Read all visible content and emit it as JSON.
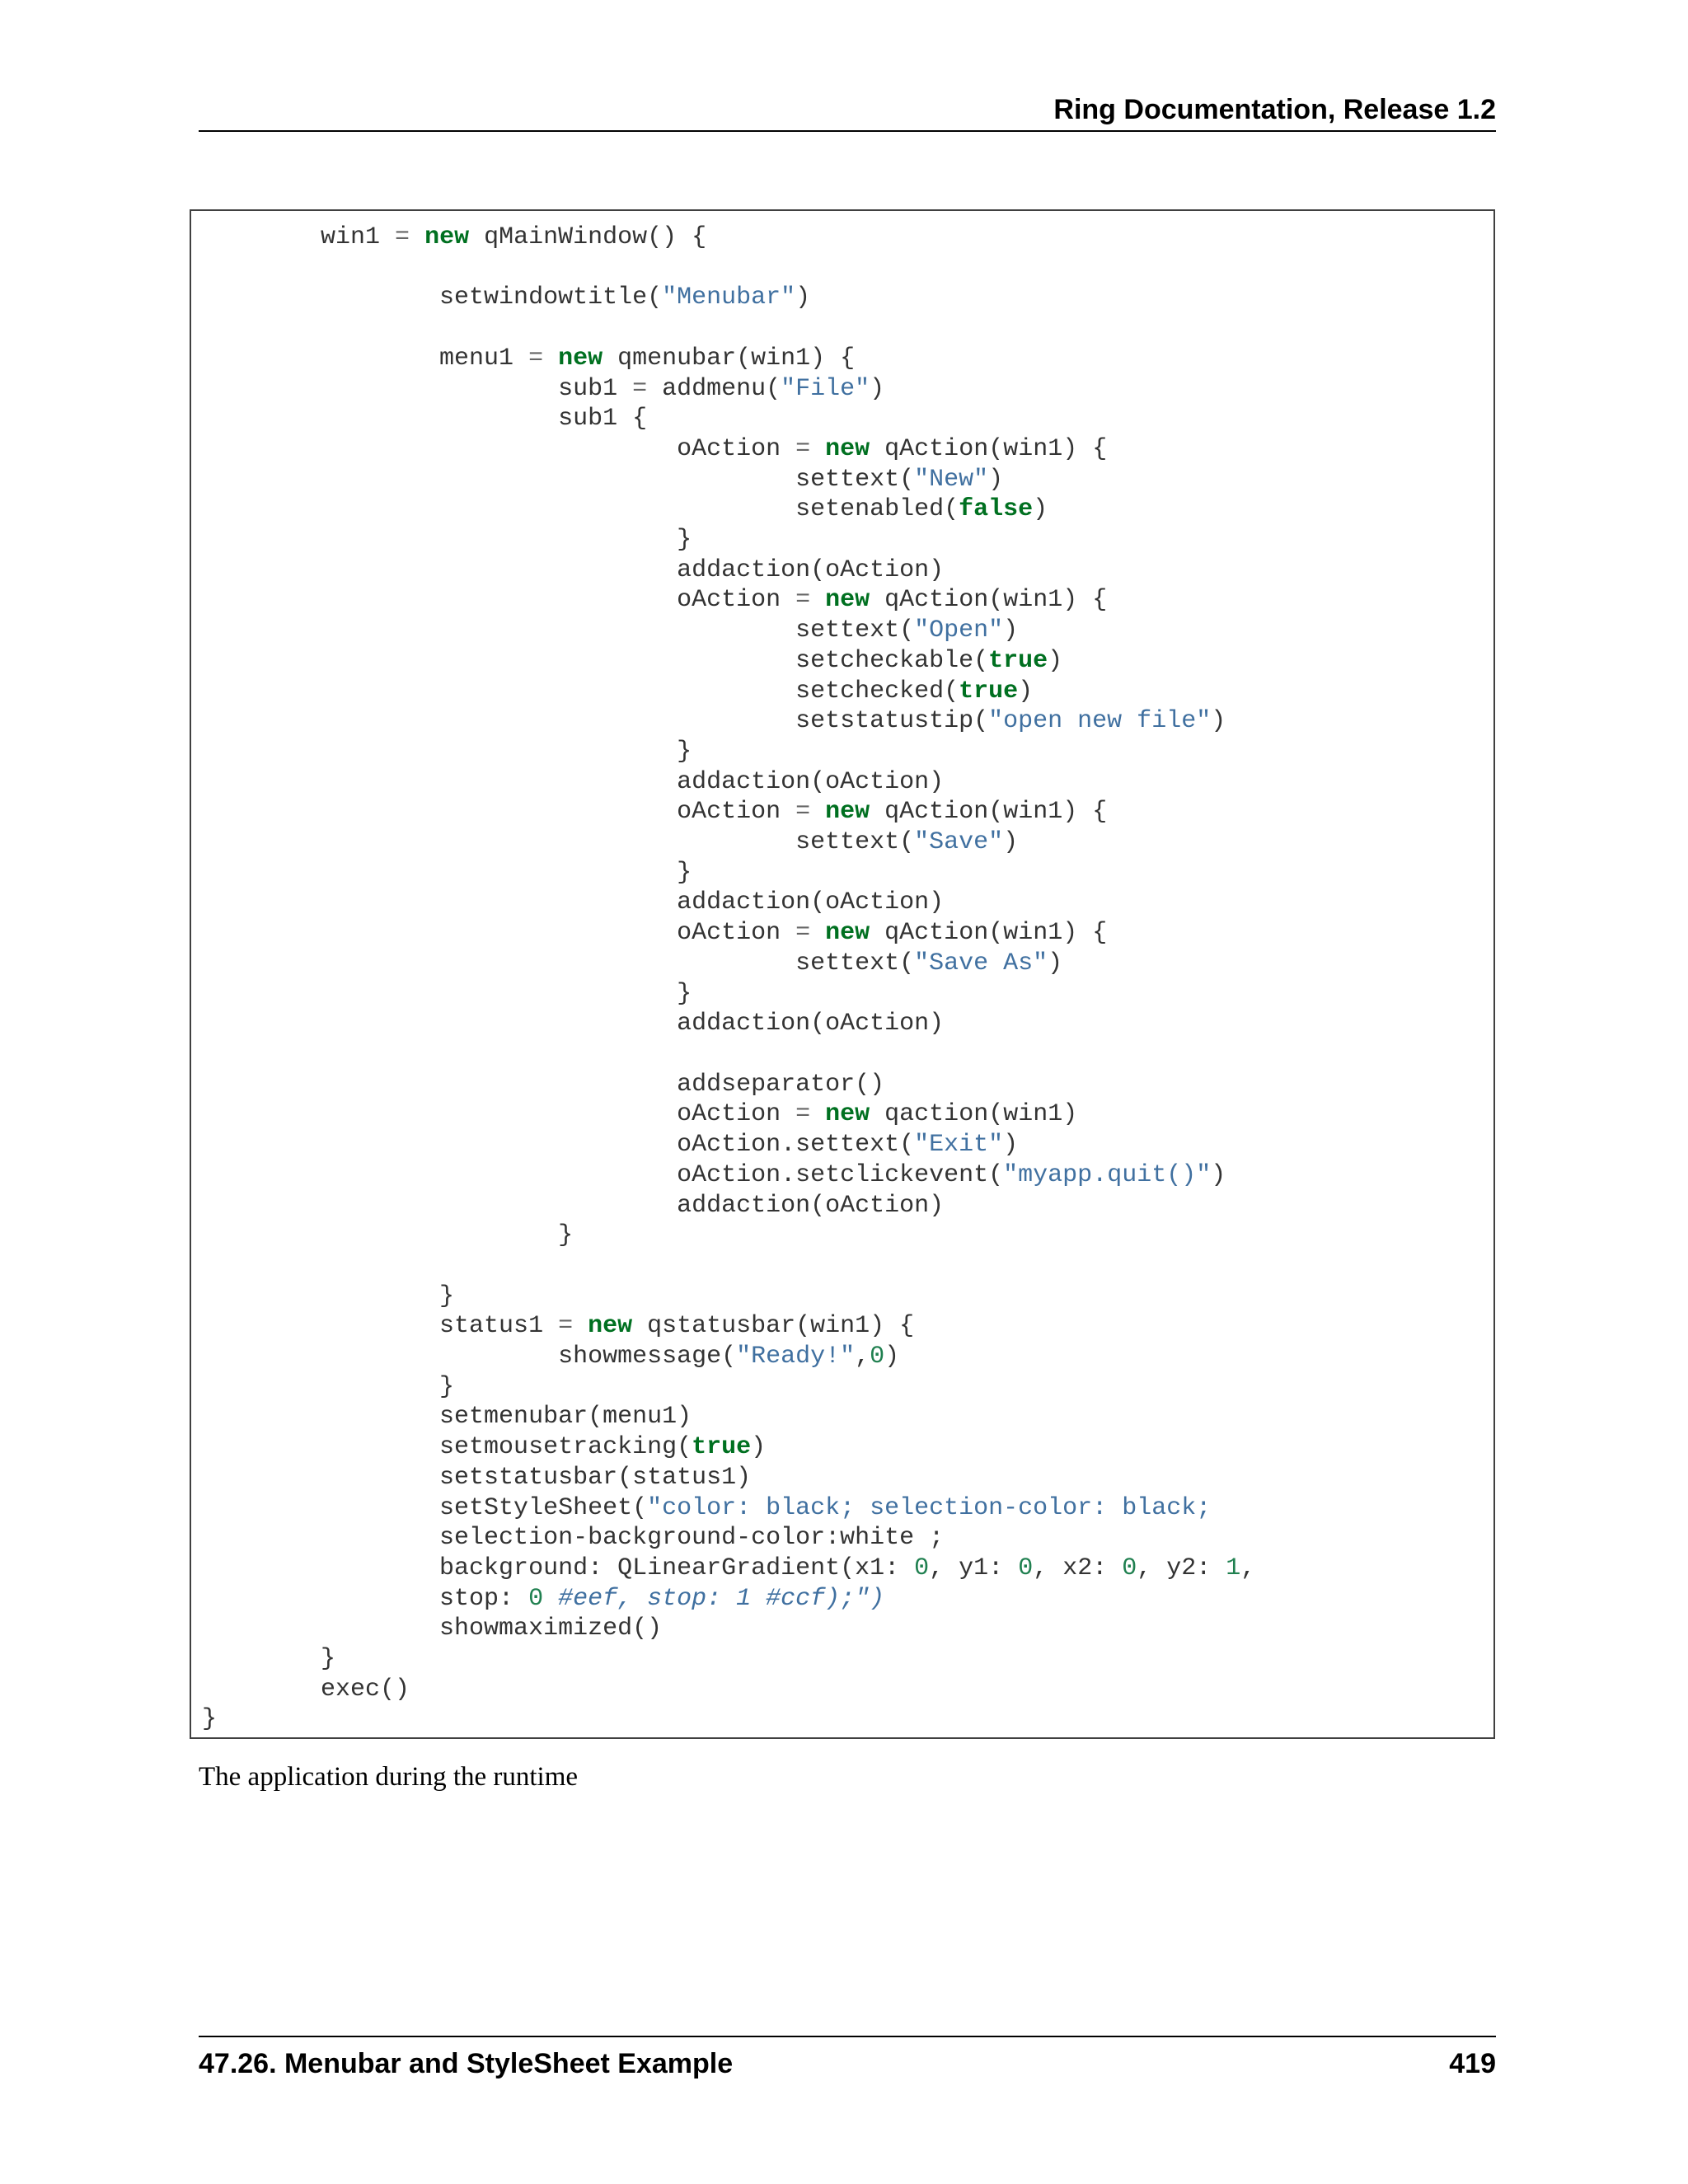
{
  "header": {
    "title": "Ring Documentation, Release 1.2"
  },
  "code": {
    "lines": [
      [
        {
          "t": "        win1 "
        },
        {
          "t": "=",
          "c": "op"
        },
        {
          "t": " "
        },
        {
          "t": "new",
          "c": "kw"
        },
        {
          "t": " qMainWindow() {"
        }
      ],
      [
        {
          "t": ""
        }
      ],
      [
        {
          "t": "                setwindowtitle("
        },
        {
          "t": "\"Menubar\"",
          "c": "str"
        },
        {
          "t": ")"
        }
      ],
      [
        {
          "t": ""
        }
      ],
      [
        {
          "t": "                menu1 "
        },
        {
          "t": "=",
          "c": "op"
        },
        {
          "t": " "
        },
        {
          "t": "new",
          "c": "kw"
        },
        {
          "t": " qmenubar(win1) {"
        }
      ],
      [
        {
          "t": "                        sub1 "
        },
        {
          "t": "=",
          "c": "op"
        },
        {
          "t": " addmenu("
        },
        {
          "t": "\"File\"",
          "c": "str"
        },
        {
          "t": ")"
        }
      ],
      [
        {
          "t": "                        sub1 {"
        }
      ],
      [
        {
          "t": "                                oAction "
        },
        {
          "t": "=",
          "c": "op"
        },
        {
          "t": " "
        },
        {
          "t": "new",
          "c": "kw"
        },
        {
          "t": " qAction(win1) {"
        }
      ],
      [
        {
          "t": "                                        settext("
        },
        {
          "t": "\"New\"",
          "c": "str"
        },
        {
          "t": ")"
        }
      ],
      [
        {
          "t": "                                        setenabled("
        },
        {
          "t": "false",
          "c": "kw"
        },
        {
          "t": ")"
        }
      ],
      [
        {
          "t": "                                }"
        }
      ],
      [
        {
          "t": "                                addaction(oAction)"
        }
      ],
      [
        {
          "t": "                                oAction "
        },
        {
          "t": "=",
          "c": "op"
        },
        {
          "t": " "
        },
        {
          "t": "new",
          "c": "kw"
        },
        {
          "t": " qAction(win1) {"
        }
      ],
      [
        {
          "t": "                                        settext("
        },
        {
          "t": "\"Open\"",
          "c": "str"
        },
        {
          "t": ")"
        }
      ],
      [
        {
          "t": "                                        setcheckable("
        },
        {
          "t": "true",
          "c": "kw"
        },
        {
          "t": ")"
        }
      ],
      [
        {
          "t": "                                        setchecked("
        },
        {
          "t": "true",
          "c": "kw"
        },
        {
          "t": ")"
        }
      ],
      [
        {
          "t": "                                        setstatustip("
        },
        {
          "t": "\"open new file\"",
          "c": "str"
        },
        {
          "t": ")"
        }
      ],
      [
        {
          "t": "                                }"
        }
      ],
      [
        {
          "t": "                                addaction(oAction)"
        }
      ],
      [
        {
          "t": "                                oAction "
        },
        {
          "t": "=",
          "c": "op"
        },
        {
          "t": " "
        },
        {
          "t": "new",
          "c": "kw"
        },
        {
          "t": " qAction(win1) {"
        }
      ],
      [
        {
          "t": "                                        settext("
        },
        {
          "t": "\"Save\"",
          "c": "str"
        },
        {
          "t": ")"
        }
      ],
      [
        {
          "t": "                                }"
        }
      ],
      [
        {
          "t": "                                addaction(oAction)"
        }
      ],
      [
        {
          "t": "                                oAction "
        },
        {
          "t": "=",
          "c": "op"
        },
        {
          "t": " "
        },
        {
          "t": "new",
          "c": "kw"
        },
        {
          "t": " qAction(win1) {"
        }
      ],
      [
        {
          "t": "                                        settext("
        },
        {
          "t": "\"Save As\"",
          "c": "str"
        },
        {
          "t": ")"
        }
      ],
      [
        {
          "t": "                                }"
        }
      ],
      [
        {
          "t": "                                addaction(oAction)"
        }
      ],
      [
        {
          "t": ""
        }
      ],
      [
        {
          "t": "                                addseparator()"
        }
      ],
      [
        {
          "t": "                                oAction "
        },
        {
          "t": "=",
          "c": "op"
        },
        {
          "t": " "
        },
        {
          "t": "new",
          "c": "kw"
        },
        {
          "t": " qaction(win1)"
        }
      ],
      [
        {
          "t": "                                oAction.settext("
        },
        {
          "t": "\"Exit\"",
          "c": "str"
        },
        {
          "t": ")"
        }
      ],
      [
        {
          "t": "                                oAction.setclickevent("
        },
        {
          "t": "\"myapp.quit()\"",
          "c": "str"
        },
        {
          "t": ")"
        }
      ],
      [
        {
          "t": "                                addaction(oAction)"
        }
      ],
      [
        {
          "t": "                        }"
        }
      ],
      [
        {
          "t": ""
        }
      ],
      [
        {
          "t": "                }"
        }
      ],
      [
        {
          "t": "                status1 "
        },
        {
          "t": "=",
          "c": "op"
        },
        {
          "t": " "
        },
        {
          "t": "new",
          "c": "kw"
        },
        {
          "t": " qstatusbar(win1) {"
        }
      ],
      [
        {
          "t": "                        showmessage("
        },
        {
          "t": "\"Ready!\"",
          "c": "str"
        },
        {
          "t": ","
        },
        {
          "t": "0",
          "c": "num"
        },
        {
          "t": ")"
        }
      ],
      [
        {
          "t": "                }"
        }
      ],
      [
        {
          "t": "                setmenubar(menu1)"
        }
      ],
      [
        {
          "t": "                setmousetracking("
        },
        {
          "t": "true",
          "c": "kw"
        },
        {
          "t": ")"
        }
      ],
      [
        {
          "t": "                setstatusbar(status1)"
        }
      ],
      [
        {
          "t": "                setStyleSheet("
        },
        {
          "t": "\"color: black; selection-color: black;",
          "c": "str"
        }
      ],
      [
        {
          "t": "                selection-background-color:white ;"
        }
      ],
      [
        {
          "t": "                background: QLinearGradient(x1: "
        },
        {
          "t": "0",
          "c": "num"
        },
        {
          "t": ", y1: "
        },
        {
          "t": "0",
          "c": "num"
        },
        {
          "t": ", x2: "
        },
        {
          "t": "0",
          "c": "num"
        },
        {
          "t": ", y2: "
        },
        {
          "t": "1",
          "c": "num"
        },
        {
          "t": ","
        }
      ],
      [
        {
          "t": "                stop: "
        },
        {
          "t": "0",
          "c": "num"
        },
        {
          "t": " "
        },
        {
          "t": "#eef, stop: 1 #ccf);\")",
          "c": "it"
        }
      ],
      [
        {
          "t": "                showmaximized()"
        }
      ],
      [
        {
          "t": "        }"
        }
      ],
      [
        {
          "t": "        exec()"
        }
      ],
      [
        {
          "t": "}"
        }
      ]
    ]
  },
  "caption": "The application during the runtime",
  "footer": {
    "section": "47.26.  Menubar and StyleSheet Example",
    "page": "419"
  }
}
